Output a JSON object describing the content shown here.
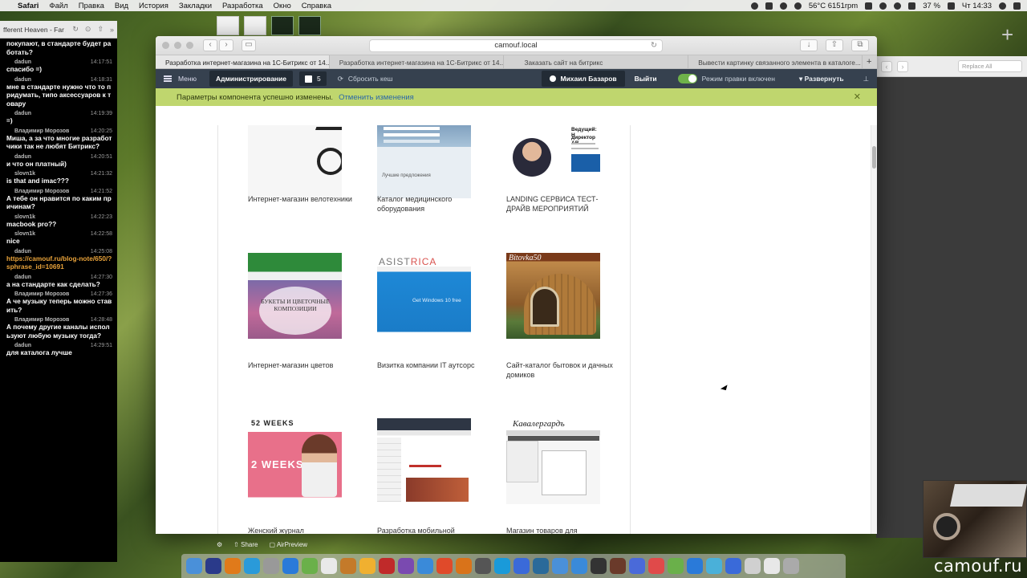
{
  "menubar": {
    "app": "Safari",
    "items": [
      "Файл",
      "Правка",
      "Вид",
      "История",
      "Закладки",
      "Разработка",
      "Окно",
      "Справка"
    ],
    "status": {
      "temp": "56°C 6151rpm",
      "battery": "37 %",
      "clock": "Чт 14:33"
    }
  },
  "chat": {
    "now_playing": "fferent Heaven - Far Away (Phan...",
    "messages": [
      {
        "who": "",
        "time": "",
        "text": "покупают, в стандарте будет работать?"
      },
      {
        "who": "dadun",
        "time": "14:17:51",
        "text": "спасибо =)"
      },
      {
        "who": "dadun",
        "time": "14:18:31",
        "text": "мне в стандарте нужно что то придумать, типо аксессуаров к товару"
      },
      {
        "who": "dadun",
        "time": "14:19:39",
        "text": "=)"
      },
      {
        "who": "Владимир Морозов",
        "time": "14:20:25",
        "text": "Миша, а за что многие разработчики так не любят Битрикс?"
      },
      {
        "who": "dadun",
        "time": "14:20:51",
        "text": "и что он платный)"
      },
      {
        "who": "slovn1k",
        "time": "14:21:32",
        "text": "is that and imac???"
      },
      {
        "who": "Владимир Морозов",
        "time": "14:21:52",
        "text": "А тебе он нравится по каким причинам?"
      },
      {
        "who": "slovn1k",
        "time": "14:22:23",
        "text": "macbook pro??"
      },
      {
        "who": "slovn1k",
        "time": "14:22:58",
        "text": "nice"
      },
      {
        "who": "dadun",
        "time": "14:25:08",
        "text": "https://camouf.ru/blog-note/650/?sphrase_id=10691",
        "link": true
      },
      {
        "who": "dadun",
        "time": "14:27:30",
        "text": "а на стандарте как сделать?"
      },
      {
        "who": "Владимир Морозов",
        "time": "14:27:36",
        "text": "А че музыку теперь можно ставить?"
      },
      {
        "who": "Владимир Морозов",
        "time": "14:28:48",
        "text": "А почему другие каналы используют любую музыку тогда?"
      },
      {
        "who": "dadun",
        "time": "14:29:51",
        "text": "для каталога лучше"
      }
    ]
  },
  "browser": {
    "address": "camouf.local",
    "tabs": [
      "Разработка интернет-магазина на 1С-Битрикс от 14...",
      "Разработка интернет-магазина на 1С-Битрикс от 14...",
      "Заказать сайт на битрикс",
      "Вывести картинку связанного элемента в каталоге..."
    ],
    "active_tab": 0
  },
  "admin_panel": {
    "menu": "Меню",
    "admin": "Администрирование",
    "count": "5",
    "reset_cache": "Сбросить кеш",
    "user": "Михаил Базаров",
    "logout": "Выйти",
    "edit_mode": "Режим правки включен",
    "expand": "Развернуть"
  },
  "notification": {
    "text": "Параметры компонента успешно изменены.",
    "cancel": "Отменить изменения"
  },
  "portfolio": [
    {
      "caption": "Интернет-магазин велотехники"
    },
    {
      "caption": "Каталог медицинского оборудования"
    },
    {
      "caption": "LANDING СЕРВИСА ТЕСТ-ДРАЙВ МЕРОПРИЯТИЙ"
    },
    {
      "caption": "Интернет-магазин цветов"
    },
    {
      "caption": "Визитка компании IT аутсорс"
    },
    {
      "caption": "Сайт-каталог бытовок и дачных домиков"
    },
    {
      "caption": "Женский журнал"
    },
    {
      "caption": "Разработка мобильной"
    },
    {
      "caption": "Магазин товаров для"
    }
  ],
  "thumb_text": {
    "flowers": "БУКЕТЫ И ЦВЕТОЧНЫЕ КОМПОЗИЦИИ",
    "asist_a": "ASIST",
    "asist_b": "RICA",
    "windows": "Get Windows 10 free",
    "cabin": "Bitovka50",
    "weeks_logo": "52 WEEKS",
    "weeks_big": "2 WEEKS",
    "kav": "Кавалергардъ",
    "landing_head": "Ведущий: Н",
    "landing_sub": "директор АВ",
    "med_label": "Лучшие предложения"
  },
  "status_strip": {
    "share": "Share",
    "airpreview": "AirPreview"
  },
  "ghost": {
    "replace": "Replace",
    "all": "All"
  },
  "watermark": "camouf.ru"
}
